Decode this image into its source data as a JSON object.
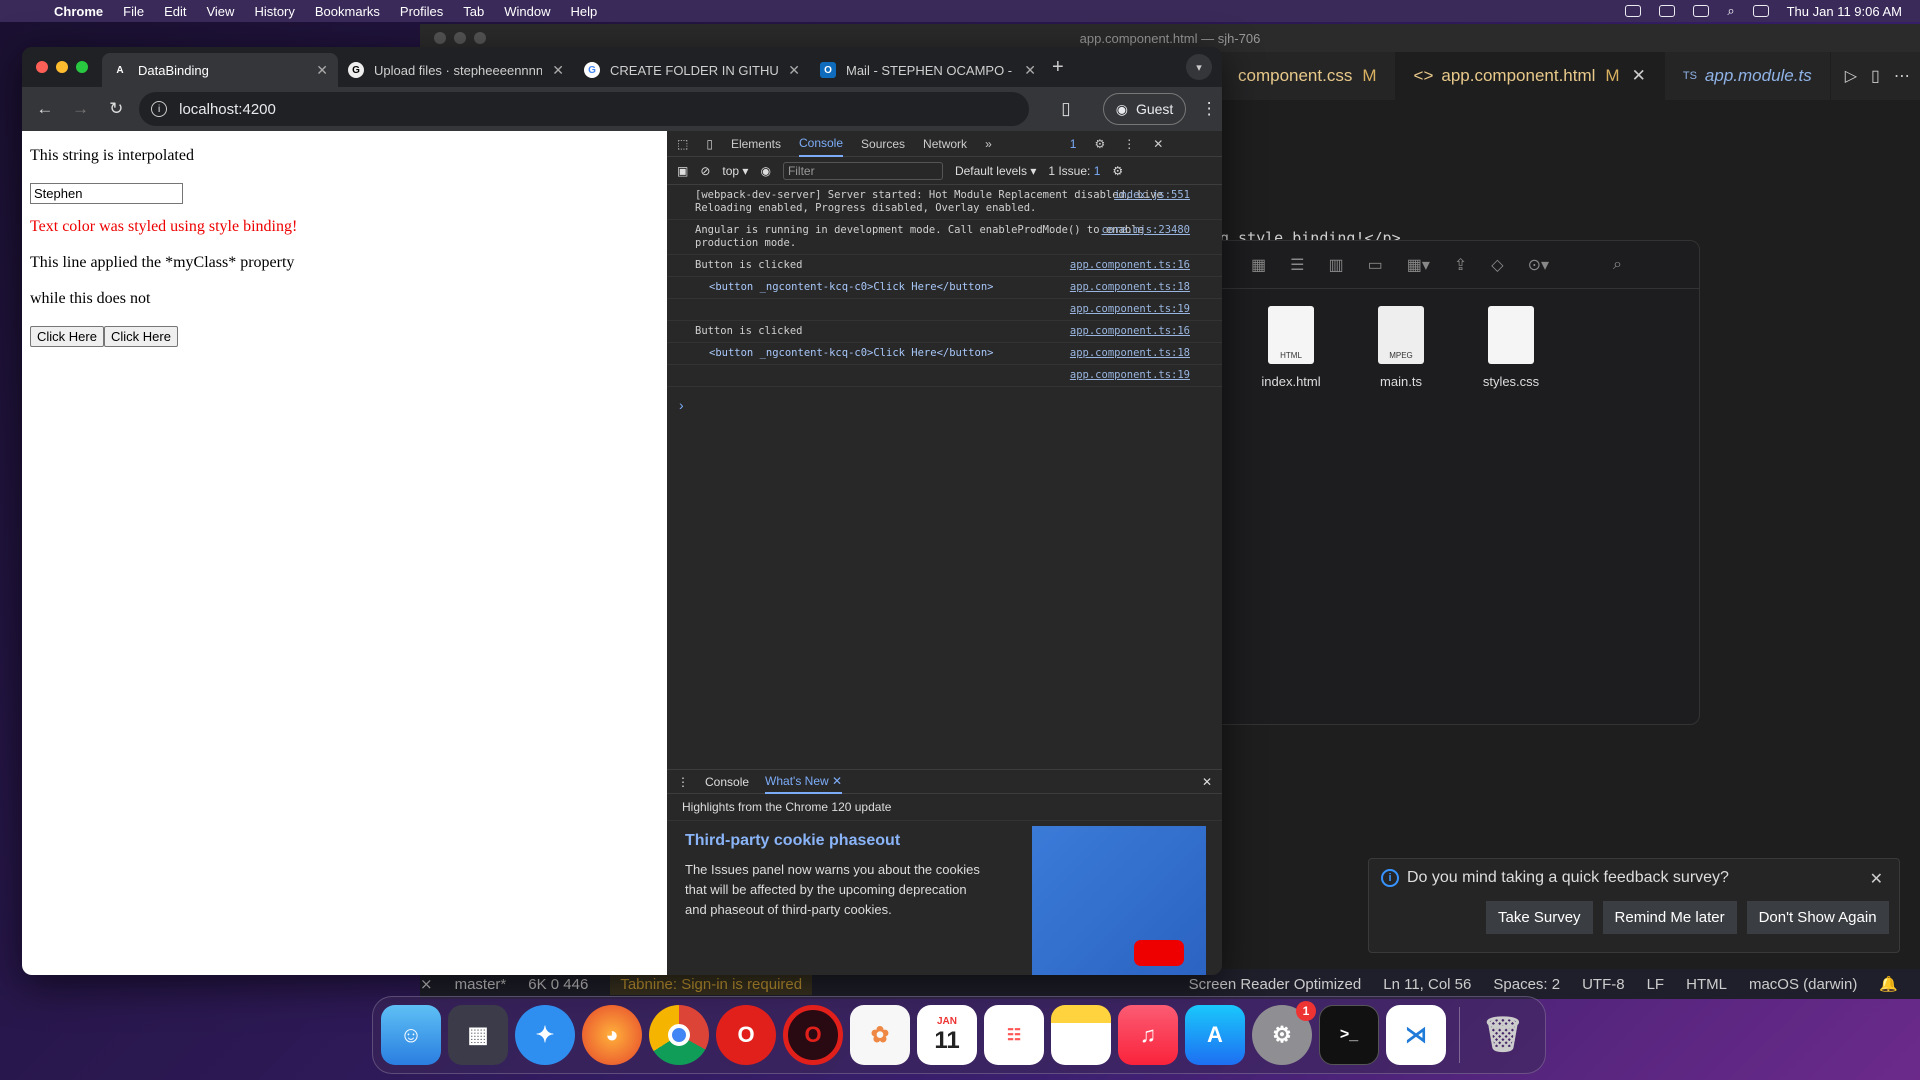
{
  "menubar": {
    "app": "Chrome",
    "items": [
      "File",
      "Edit",
      "View",
      "History",
      "Bookmarks",
      "Profiles",
      "Tab",
      "Window",
      "Help"
    ],
    "clock": "Thu Jan 11  9:06 AM"
  },
  "vscode": {
    "window_title": "app.component.html — sjh-706",
    "tabs": [
      {
        "label": "component.css",
        "mod": "M"
      },
      {
        "label": "app.component.html",
        "mod": "M"
      },
      {
        "label": "app.module.ts",
        "mod": ""
      }
    ],
    "code_line": "g style binding!</p>",
    "status": {
      "branch": "master*",
      "problems": "6K  0  446",
      "tabnine": "Tabnine: Sign-in is required",
      "screen_reader": "Screen Reader Optimized",
      "position": "Ln 11, Col 56",
      "spaces": "Spaces: 2",
      "encoding": "UTF-8",
      "eol": "LF",
      "lang": "HTML",
      "os": "macOS (darwin)"
    }
  },
  "finder": {
    "files": [
      {
        "name": "index.html",
        "tag": "HTML"
      },
      {
        "name": "main.ts",
        "tag": "MPEG"
      },
      {
        "name": "styles.css",
        "tag": ""
      }
    ]
  },
  "survey": {
    "question": "Do you mind taking a quick feedback survey?",
    "take": "Take Survey",
    "remind": "Remind Me later",
    "dont": "Don't Show Again"
  },
  "chrome": {
    "tabs": [
      {
        "title": "DataBinding",
        "icon": "A"
      },
      {
        "title": "Upload files · stepheeeennnn",
        "icon": "G"
      },
      {
        "title": "CREATE FOLDER IN GITHUB",
        "icon": "G"
      },
      {
        "title": "Mail - STEPHEN OCAMPO - O",
        "icon": "O"
      }
    ],
    "url": "localhost:4200",
    "guest": "Guest"
  },
  "page": {
    "interp": "This string is interpolated",
    "input_value": "Stephen",
    "styled": "Text color was styled using style binding!",
    "myclass": "This line applied the *myClass* property",
    "notclass": "while this does not",
    "btn1": "Click Here",
    "btn2": "Click Here"
  },
  "devtools": {
    "tabs": [
      "Elements",
      "Console",
      "Sources",
      "Network"
    ],
    "issues_badge": "1",
    "context": "top",
    "filter_placeholder": "Filter",
    "levels": "Default levels",
    "issues": "1 Issue:",
    "issues_count": "1",
    "logs": [
      {
        "text": "[webpack-dev-server] Server started: Hot Module Replacement disabled, Live Reloading enabled, Progress disabled, Overlay enabled.",
        "src": "index.js:551"
      },
      {
        "text": "Angular is running in development mode. Call enableProdMode() to enable production mode.",
        "src": "core.mjs:23480"
      },
      {
        "text": "Button is clicked",
        "src": "app.component.ts:16"
      },
      {
        "text": "<button _ngcontent-kcq-c0>Click Here</button>",
        "src": "app.component.ts:18",
        "sub": true
      },
      {
        "text": "",
        "src": "app.component.ts:19"
      },
      {
        "text": "Button is clicked",
        "src": "app.component.ts:16"
      },
      {
        "text": "<button _ngcontent-kcq-c0>Click Here</button>",
        "src": "app.component.ts:18",
        "sub": true
      },
      {
        "text": "",
        "src": "app.component.ts:19"
      }
    ],
    "drawer": {
      "tab1": "Console",
      "tab2": "What's New",
      "highlights": "Highlights from the Chrome 120 update",
      "heading": "Third-party cookie phaseout",
      "desc": "The Issues panel now warns you about the cookies that will be affected by the upcoming deprecation and phaseout of third-party cookies."
    }
  },
  "dock": {
    "calendar_month": "JAN",
    "calendar_day": "11",
    "settings_badge": "1"
  }
}
